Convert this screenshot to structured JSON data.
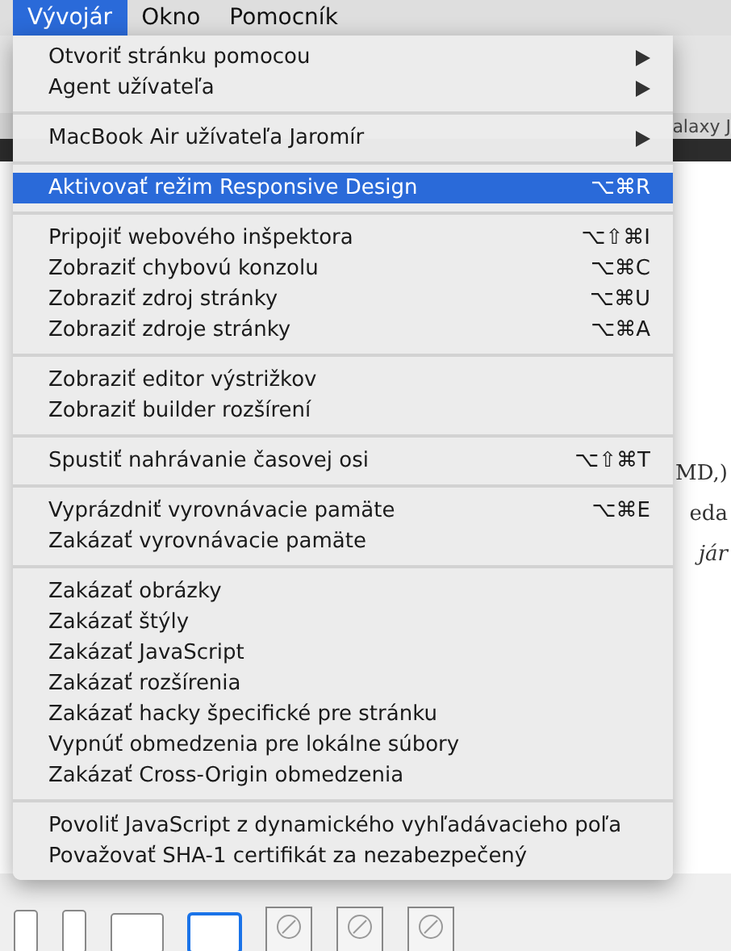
{
  "menubar": [
    {
      "label": "Vývojár",
      "selected": true
    },
    {
      "label": "Okno",
      "selected": false
    },
    {
      "label": "Pomocník",
      "selected": false
    }
  ],
  "menu": {
    "sections": [
      {
        "items": [
          {
            "label": "Otvoriť stránku pomocou",
            "submenu": true,
            "selected": false
          },
          {
            "label": "Agent užívateľa",
            "submenu": true,
            "selected": false
          }
        ]
      },
      {
        "items": [
          {
            "label": "MacBook Air užívateľa Jaromír",
            "submenu": true,
            "selected": false
          }
        ]
      },
      {
        "items": [
          {
            "label": "Aktivovať režim Responsive Design",
            "shortcut": "⌥⌘R",
            "selected": true
          }
        ]
      },
      {
        "items": [
          {
            "label": "Pripojiť webového inšpektora",
            "shortcut": "⌥⇧⌘I",
            "selected": false
          },
          {
            "label": "Zobraziť chybovú konzolu",
            "shortcut": "⌥⌘C",
            "selected": false
          },
          {
            "label": "Zobraziť zdroj stránky",
            "shortcut": "⌥⌘U",
            "selected": false
          },
          {
            "label": "Zobraziť zdroje stránky",
            "shortcut": "⌥⌘A",
            "selected": false
          }
        ]
      },
      {
        "items": [
          {
            "label": "Zobraziť editor výstrižkov",
            "selected": false
          },
          {
            "label": "Zobraziť builder rozšírení",
            "selected": false
          }
        ]
      },
      {
        "items": [
          {
            "label": "Spustiť nahrávanie časovej osi",
            "shortcut": "⌥⇧⌘T",
            "selected": false
          }
        ]
      },
      {
        "items": [
          {
            "label": "Vyprázdniť vyrovnávacie pamäte",
            "shortcut": "⌥⌘E",
            "selected": false
          },
          {
            "label": "Zakázať vyrovnávacie pamäte",
            "selected": false
          }
        ]
      },
      {
        "items": [
          {
            "label": "Zakázať obrázky",
            "selected": false
          },
          {
            "label": "Zakázať štýly",
            "selected": false
          },
          {
            "label": "Zakázať JavaScript",
            "selected": false
          },
          {
            "label": "Zakázať rozšírenia",
            "selected": false
          },
          {
            "label": "Zakázať hacky špecifické pre stránku",
            "selected": false
          },
          {
            "label": "Vypnúť obmedzenia pre lokálne súbory",
            "selected": false
          },
          {
            "label": "Zakázať Cross-Origin obmedzenia",
            "selected": false
          }
        ]
      },
      {
        "items": [
          {
            "label": "Povoliť JavaScript z dynamického vyhľadávacieho poľa",
            "selected": false
          },
          {
            "label": "Považovať SHA-1 certifikát za nezabezpečený",
            "selected": false
          }
        ]
      }
    ]
  },
  "background": {
    "tab_fragment": "alaxy J",
    "text_fragments": [
      {
        "text": "MD,)",
        "italic": false
      },
      {
        "text": "eda",
        "italic": false
      },
      {
        "text": "jár",
        "italic": true
      }
    ],
    "devices": [
      {
        "kind": "phone",
        "selected": false
      },
      {
        "kind": "phone",
        "selected": false
      },
      {
        "kind": "tablet",
        "selected": false
      },
      {
        "kind": "tablet",
        "selected": true
      },
      {
        "kind": "browser",
        "selected": false
      },
      {
        "kind": "browser",
        "selected": false
      },
      {
        "kind": "browser",
        "selected": false
      }
    ]
  }
}
